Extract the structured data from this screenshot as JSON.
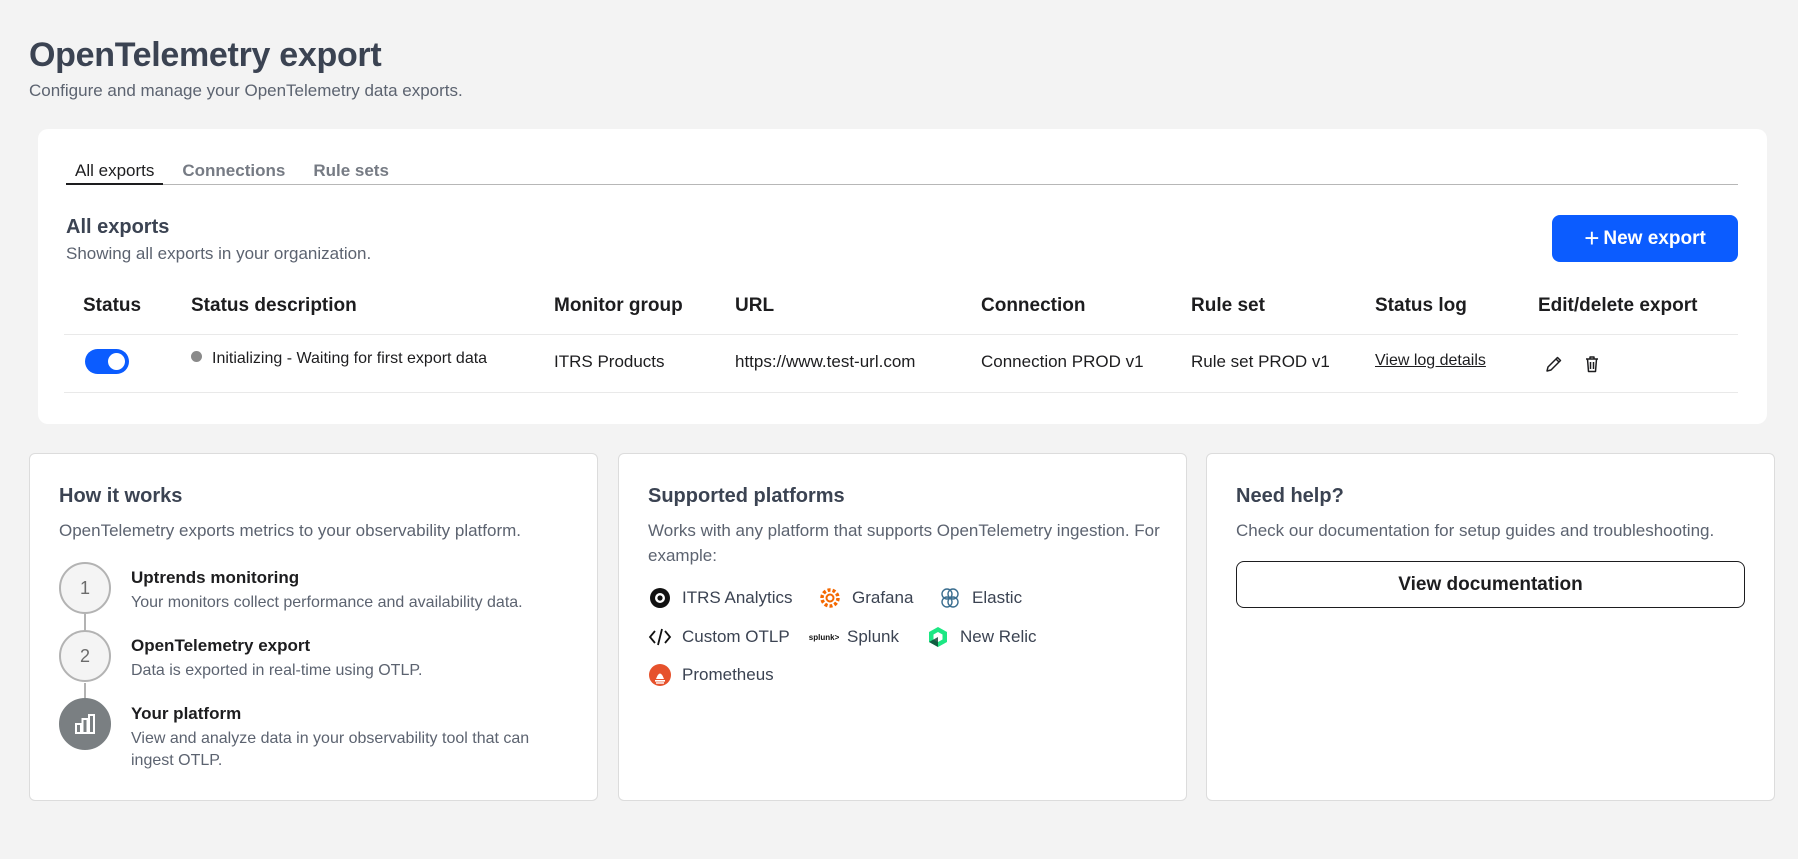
{
  "page": {
    "title": "OpenTelemetry export",
    "subtitle": "Configure and manage your OpenTelemetry data exports."
  },
  "tabs": [
    "All exports",
    "Connections",
    "Rule sets"
  ],
  "exports_section": {
    "title": "All exports",
    "subtitle": "Showing all exports in your organization.",
    "new_button": "New export"
  },
  "table": {
    "columns": [
      "Status",
      "Status description",
      "Monitor group",
      "URL",
      "Connection",
      "Rule set",
      "Status log",
      "Edit/delete export"
    ],
    "rows": [
      {
        "enabled": true,
        "status_description": "Initializing - Waiting for first export data",
        "monitor_group": "ITRS Products",
        "url": "https://www.test-url.com",
        "connection": "Connection PROD v1",
        "rule_set": "Rule set PROD v1",
        "status_log": "View log details"
      }
    ]
  },
  "how_it_works": {
    "title": "How it works",
    "description": "OpenTelemetry exports metrics to your observability platform.",
    "steps": [
      {
        "marker": "1",
        "title": "Uptrends monitoring",
        "description": "Your monitors collect performance and availability data."
      },
      {
        "marker": "2",
        "title": "OpenTelemetry export",
        "description": "Data is exported in real-time using OTLP."
      },
      {
        "marker": "chart-icon",
        "title": "Your platform",
        "description": "View and analyze data in your observability tool that can ingest OTLP."
      }
    ]
  },
  "supported_platforms": {
    "title": "Supported platforms",
    "description": "Works with any platform that supports OpenTelemetry ingestion. For example:",
    "platforms": [
      {
        "name": "ITRS Analytics",
        "icon": "itrs-icon",
        "color": "#111111"
      },
      {
        "name": "Grafana",
        "icon": "grafana-icon",
        "color": "#f46800"
      },
      {
        "name": "Elastic",
        "icon": "elastic-icon",
        "color": "#3b6e8f"
      },
      {
        "name": "Custom OTLP",
        "icon": "code-icon",
        "color": "#111111"
      },
      {
        "name": "Splunk",
        "icon": "splunk-icon",
        "color": "#111111"
      },
      {
        "name": "New Relic",
        "icon": "newrelic-icon",
        "color": "#1ce783"
      },
      {
        "name": "Prometheus",
        "icon": "prometheus-icon",
        "color": "#e6522c"
      }
    ],
    "splunk_logo_text": "splunk>"
  },
  "help": {
    "title": "Need help?",
    "description": "Check our documentation for setup guides and troubleshooting.",
    "button": "View documentation"
  },
  "colors": {
    "accent": "#0b5cff",
    "background": "#f3f3f3",
    "heading": "#3b4352"
  }
}
